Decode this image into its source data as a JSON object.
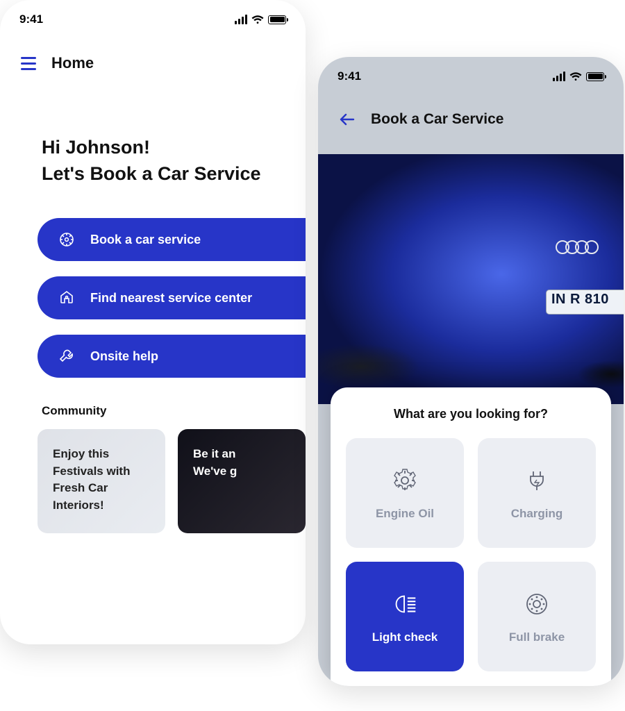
{
  "status": {
    "time": "9:41"
  },
  "left": {
    "nav_title": "Home",
    "greet_line1": "Hi Johnson!",
    "greet_line2": "Let's Book a Car Service",
    "actions": {
      "book": "Book a car service",
      "find": "Find nearest service center",
      "onsite": "Onsite help"
    },
    "community_heading": "Community",
    "cards": {
      "c1_line1": "Enjoy this Festivals with",
      "c1_line2": "Fresh Car Interiors!",
      "c2_line1": "Be it an",
      "c2_line2": "We've g"
    }
  },
  "right": {
    "title": "Book a Car Service",
    "plate": "IN R 810",
    "sheet_title": "What are you looking for?",
    "options": {
      "engine": "Engine Oil",
      "charging": "Charging",
      "light": "Light check",
      "brake": "Full brake"
    }
  }
}
